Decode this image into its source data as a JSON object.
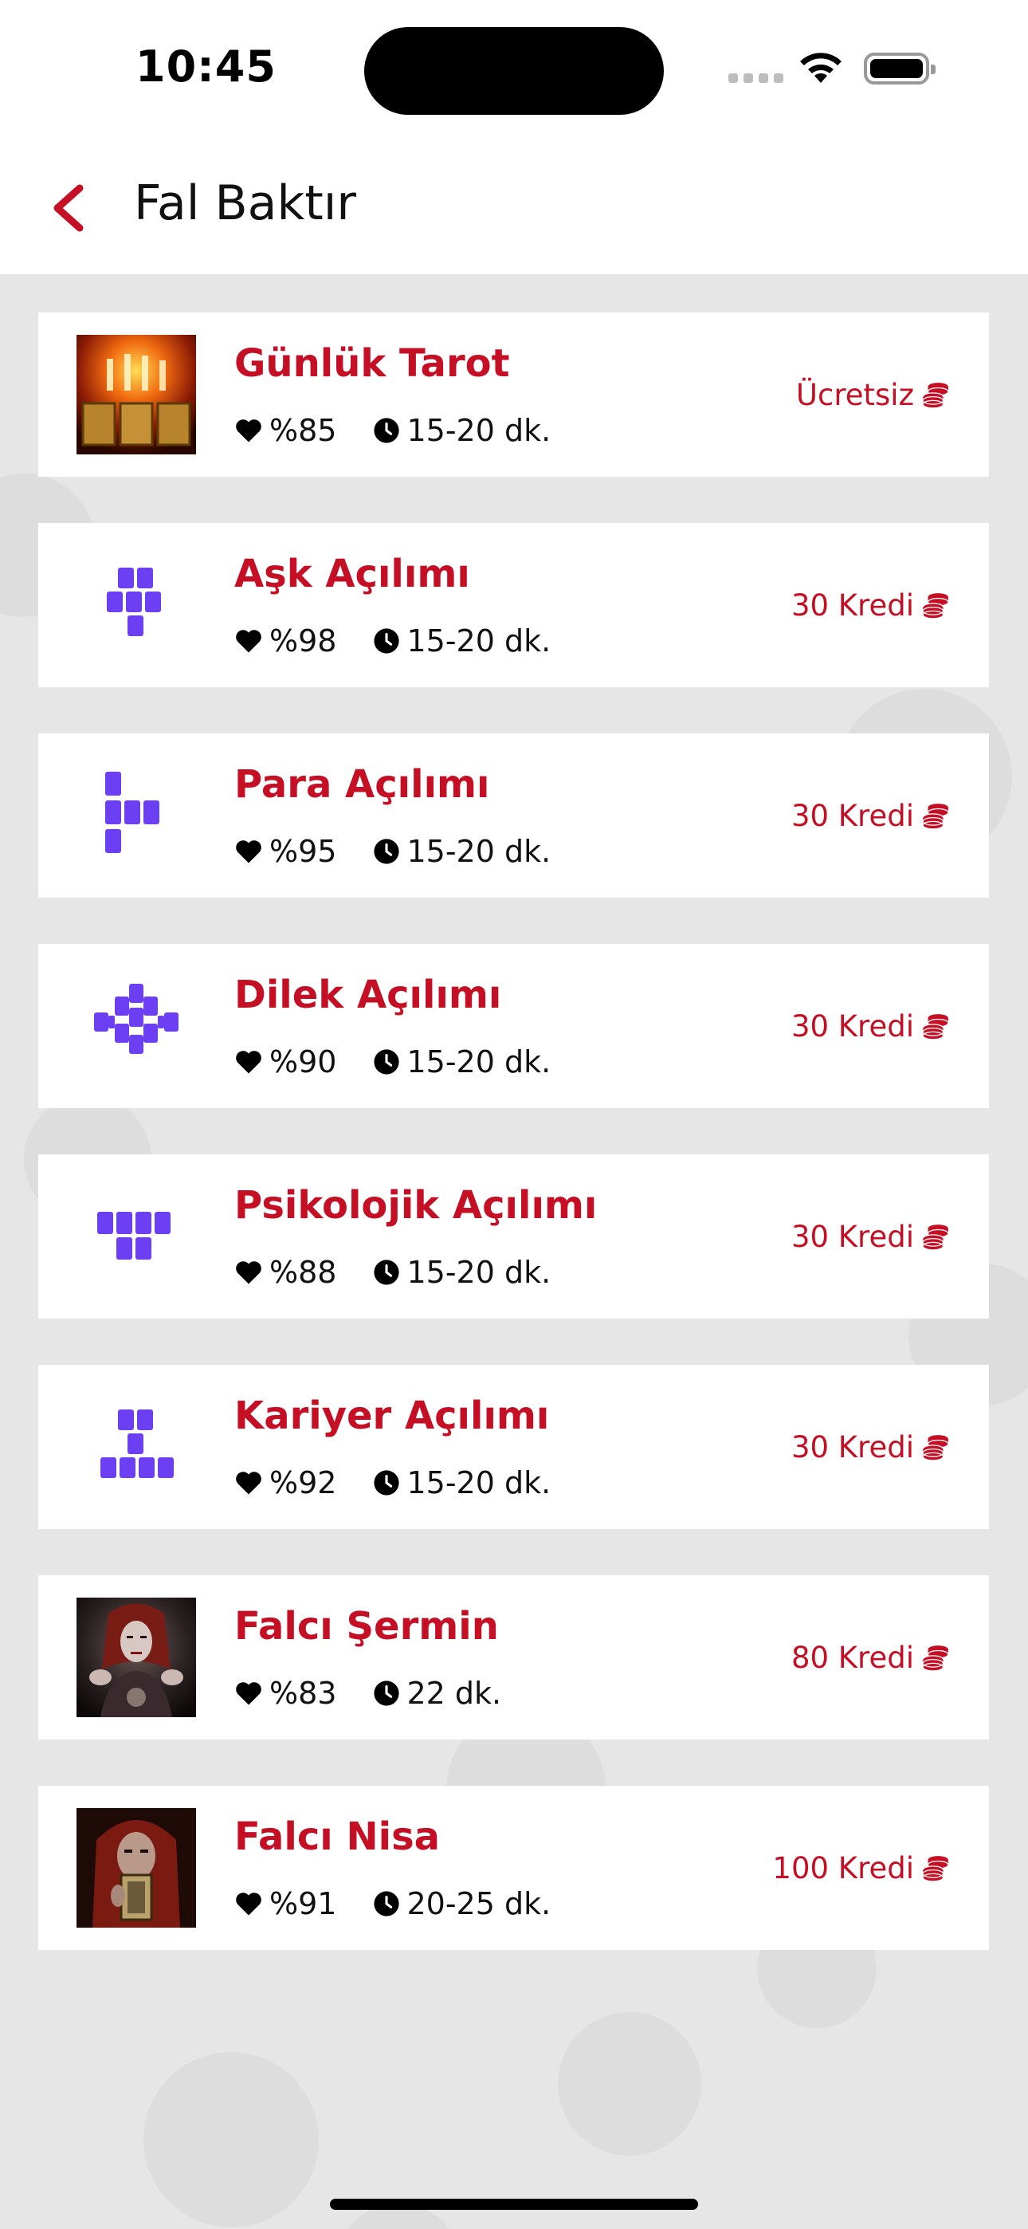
{
  "status_bar": {
    "time": "10:45"
  },
  "nav": {
    "title": "Fal Baktır"
  },
  "accent_color": "#c40f24",
  "spread_icon_color": "#6c3ff3",
  "items": [
    {
      "title": "Günlük Tarot",
      "rating": "%85",
      "duration": "15-20 dk.",
      "price": "Ücretsiz",
      "icon": "tarot-photo"
    },
    {
      "title": "Aşk Açılımı",
      "rating": "%98",
      "duration": "15-20 dk.",
      "price": "30 Kredi",
      "icon": "love-spread-icon"
    },
    {
      "title": "Para Açılımı",
      "rating": "%95",
      "duration": "15-20 dk.",
      "price": "30 Kredi",
      "icon": "money-spread-icon"
    },
    {
      "title": "Dilek Açılımı",
      "rating": "%90",
      "duration": "15-20 dk.",
      "price": "30 Kredi",
      "icon": "wish-spread-icon"
    },
    {
      "title": "Psikolojik Açılımı",
      "rating": "%88",
      "duration": "15-20 dk.",
      "price": "30 Kredi",
      "icon": "psychology-spread-icon"
    },
    {
      "title": "Kariyer Açılımı",
      "rating": "%92",
      "duration": "15-20 dk.",
      "price": "30 Kredi",
      "icon": "career-spread-icon"
    },
    {
      "title": "Falcı Şermin",
      "rating": "%83",
      "duration": "22 dk.",
      "price": "80 Kredi",
      "icon": "fortune-teller-photo"
    },
    {
      "title": "Falcı Nisa",
      "rating": "%91",
      "duration": "20-25 dk.",
      "price": "100 Kredi",
      "icon": "fortune-teller-photo"
    }
  ]
}
